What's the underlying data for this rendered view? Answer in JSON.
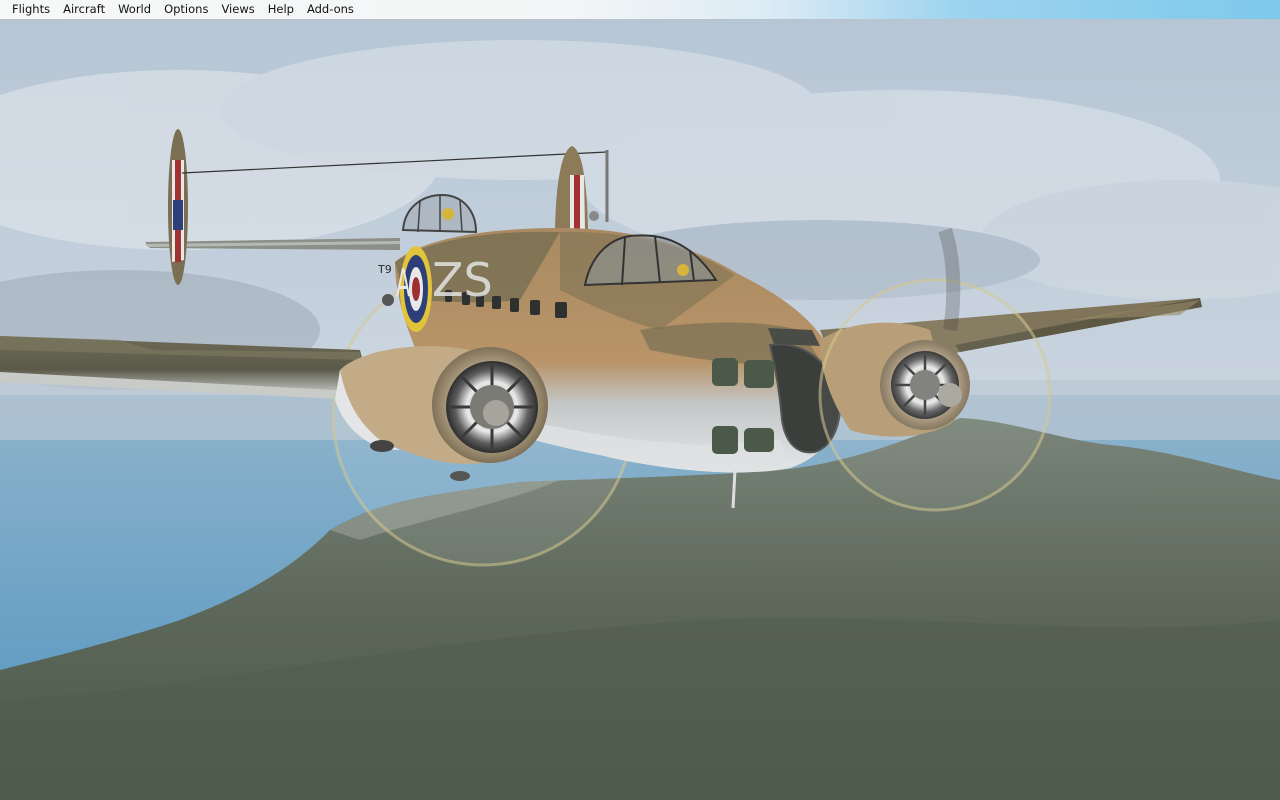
{
  "menubar": {
    "items": [
      {
        "label": "Flights"
      },
      {
        "label": "Aircraft"
      },
      {
        "label": "World"
      },
      {
        "label": "Options"
      },
      {
        "label": "Views"
      },
      {
        "label": "Help"
      },
      {
        "label": "Add-ons"
      }
    ]
  },
  "aircraft": {
    "squadron_code": "ZS",
    "individual_letter": "A",
    "serial": "T9"
  },
  "colors": {
    "sky": "#c3cfdb",
    "sea": "#5f9ec4",
    "land": "#5f6b5e",
    "camo_sand": "#b48c5d",
    "camo_olive": "#857a5a",
    "underside": "#d8dcdf",
    "roundel_yellow": "#e2c43b",
    "roundel_blue": "#2d3f78",
    "roundel_red": "#9c3030"
  }
}
